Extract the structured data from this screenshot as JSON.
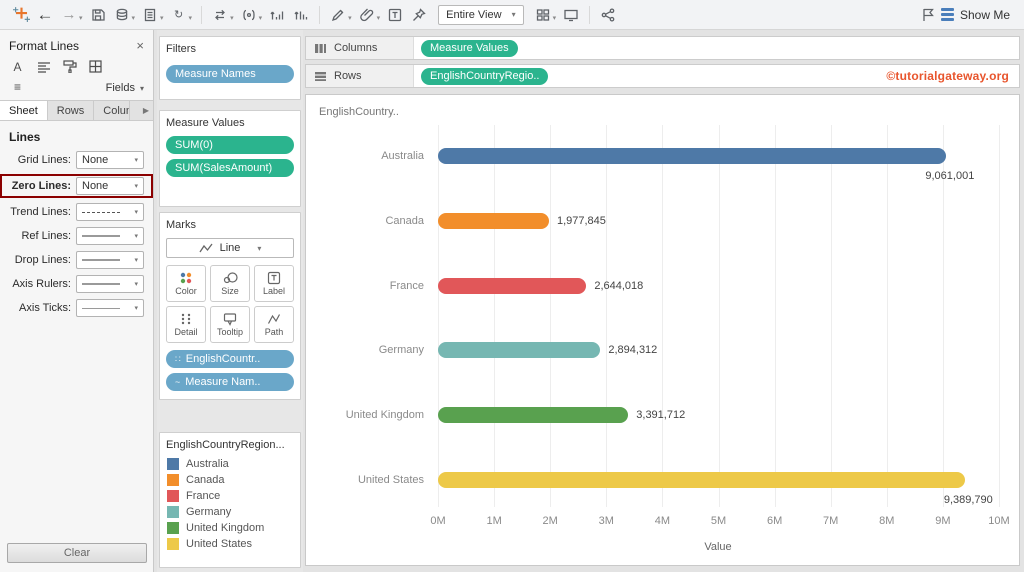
{
  "colors": {
    "pill_green": "#2bb48e",
    "pill_blue": "#6aa7c9",
    "highlight_red": "#8b0000",
    "watermark_orange": "#e8552d",
    "showme_blue": "#4a7ebb"
  },
  "icons": {
    "caret_down": "▾",
    "close": "×",
    "scroll_right": "▶",
    "back_arrow": "←",
    "forward_arrow": "→",
    "refresh": "↻",
    "font": "A",
    "lines": "≡",
    "detail_dots": "∷",
    "tilde_line": "~"
  },
  "toolbar": {
    "view_mode": "Entire View",
    "show_me_label": "Show Me"
  },
  "format_panel": {
    "title": "Format Lines",
    "fields_label": "Fields",
    "tabs": [
      "Sheet",
      "Rows",
      "Columns"
    ],
    "active_tab": "Sheet",
    "section_title": "Lines",
    "rows": [
      {
        "label": "Grid Lines:",
        "type": "text",
        "value": "None"
      },
      {
        "label": "Zero Lines:",
        "type": "text",
        "value": "None",
        "highlighted": true
      },
      {
        "label": "Trend Lines:",
        "type": "line",
        "line_style": "dashed"
      },
      {
        "label": "Ref Lines:",
        "type": "line",
        "line_style": "solid"
      },
      {
        "label": "Drop Lines:",
        "type": "line",
        "line_style": "solid"
      },
      {
        "label": "Axis Rulers:",
        "type": "line",
        "line_style": "solid"
      },
      {
        "label": "Axis Ticks:",
        "type": "line",
        "line_style": "thin"
      }
    ],
    "clear_label": "Clear"
  },
  "filters_card": {
    "title": "Filters",
    "pills": [
      {
        "label": "Measure Names",
        "color": "blue"
      }
    ]
  },
  "measure_values_card": {
    "title": "Measure Values",
    "pills": [
      {
        "label": "SUM(0)",
        "color": "green"
      },
      {
        "label": "SUM(SalesAmount)",
        "color": "green"
      }
    ]
  },
  "marks_card": {
    "title": "Marks",
    "mark_type": "Line",
    "buttons": [
      "Color",
      "Size",
      "Label",
      "Detail",
      "Tooltip",
      "Path"
    ],
    "pills": [
      {
        "label": "EnglishCountr..",
        "color": "blue",
        "icon": "detail_dots"
      },
      {
        "label": "Measure Nam..",
        "color": "blue",
        "icon": "tilde_line"
      }
    ]
  },
  "legend_card": {
    "title": "EnglishCountryRegion...",
    "items": [
      {
        "label": "Australia",
        "color": "#4e79a7"
      },
      {
        "label": "Canada",
        "color": "#f28e2b"
      },
      {
        "label": "France",
        "color": "#e15759"
      },
      {
        "label": "Germany",
        "color": "#76b7b2"
      },
      {
        "label": "United Kingdom",
        "color": "#59a14f"
      },
      {
        "label": "United States",
        "color": "#edc948"
      }
    ]
  },
  "shelves": {
    "columns_label": "Columns",
    "columns_pills": [
      "Measure Values"
    ],
    "rows_label": "Rows",
    "rows_pills": [
      "EnglishCountryRegio.."
    ],
    "watermark": "©tutorialgateway.org"
  },
  "chart_data": {
    "type": "bar",
    "orientation": "horizontal",
    "pane_header": "EnglishCountry..",
    "title": "",
    "categories": [
      "Australia",
      "Canada",
      "France",
      "Germany",
      "United Kingdom",
      "United States"
    ],
    "values": [
      9061001,
      1977845,
      2644018,
      2894312,
      3391712,
      9389790
    ],
    "value_labels": [
      "9,061,001",
      "1,977,845",
      "2,644,018",
      "2,894,312",
      "3,391,712",
      "9,389,790"
    ],
    "colors": [
      "#4e79a7",
      "#f28e2b",
      "#e15759",
      "#76b7b2",
      "#59a14f",
      "#edc948"
    ],
    "label_positions": [
      "below",
      "right",
      "right",
      "right",
      "right",
      "below"
    ],
    "xlabel": "Value",
    "ylabel": "EnglishCountryRegionName",
    "x_ticks": [
      "0M",
      "1M",
      "2M",
      "3M",
      "4M",
      "5M",
      "6M",
      "7M",
      "8M",
      "9M",
      "10M"
    ],
    "xlim": [
      0,
      10000000
    ],
    "grid": true,
    "legend_position": "left-panel"
  }
}
